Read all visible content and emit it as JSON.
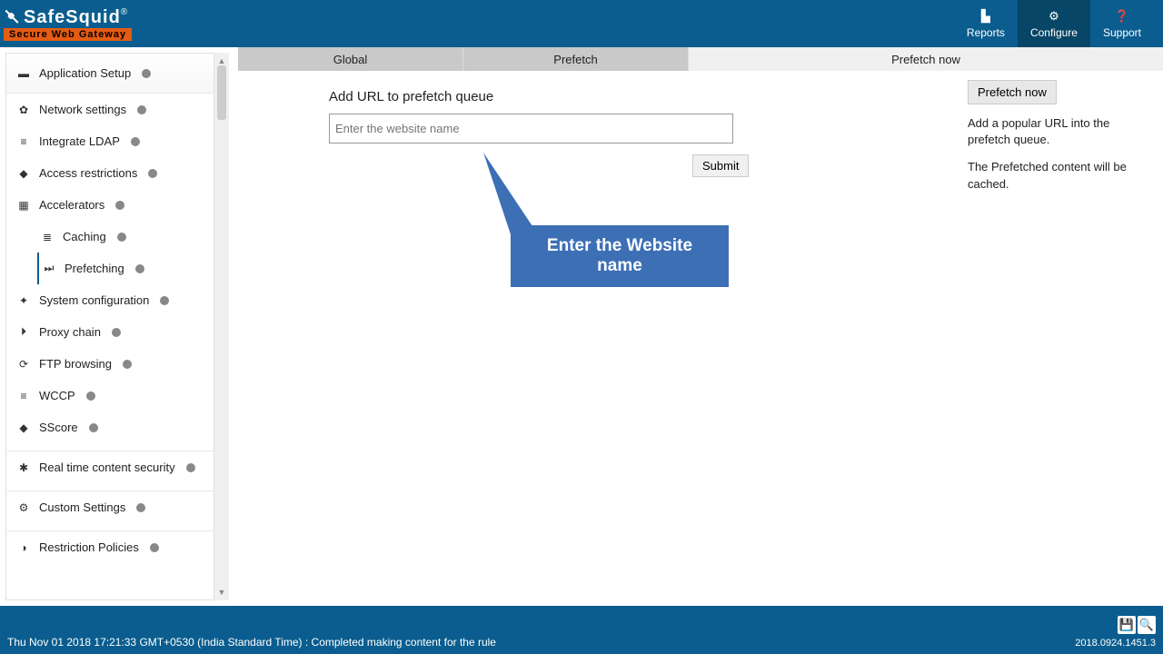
{
  "header": {
    "brand": "SafeSquid",
    "brand_reg": "®",
    "brand_sub": "Secure Web Gateway",
    "nav": {
      "reports": "Reports",
      "configure": "Configure",
      "support": "Support"
    }
  },
  "sidebar": {
    "app_setup": "Application Setup",
    "network": "Network settings",
    "ldap": "Integrate LDAP",
    "access": "Access restrictions",
    "accel": "Accelerators",
    "caching": "Caching",
    "prefetching": "Prefetching",
    "sysconf": "System configuration",
    "proxy": "Proxy chain",
    "ftp": "FTP browsing",
    "wccp": "WCCP",
    "sscore": "SScore",
    "rtcs": "Real time content security",
    "custom": "Custom Settings",
    "restrict": "Restriction Policies"
  },
  "tabs": {
    "global": "Global",
    "prefetch": "Prefetch",
    "prefetch_now": "Prefetch now"
  },
  "form": {
    "title": "Add URL to prefetch queue",
    "placeholder": "Enter the website name",
    "submit": "Submit"
  },
  "callout": {
    "text": "Enter the Website name"
  },
  "panel": {
    "btn": "Prefetch now",
    "line1": "Add a popular URL into the prefetch queue.",
    "line2": "The Prefetched content will be cached."
  },
  "footer": {
    "status": "Thu Nov 01 2018 17:21:33 GMT+0530 (India Standard Time) : Completed making content for the rule",
    "version": "2018.0924.1451.3"
  }
}
